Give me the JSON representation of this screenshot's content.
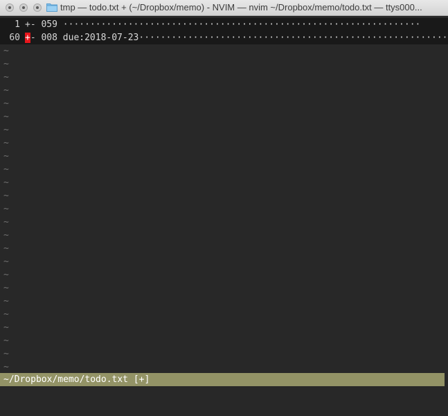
{
  "window": {
    "title": "tmp — todo.txt + (~/Dropbox/memo) - NVIM — nvim ~/Dropbox/memo/todo.txt — ttys000..."
  },
  "editor": {
    "folds": [
      {
        "line_number": "1",
        "marker": "+-",
        "text": " 059 ",
        "dots": "··································································"
      },
      {
        "line_number": "60",
        "marker_cursor": "+",
        "marker_rest": "-",
        "text": " 008 due:2018-07-23",
        "dots": "································································"
      }
    ],
    "empty_line_marker": "~",
    "empty_line_count": 25
  },
  "statusline": {
    "text": "~/Dropbox/memo/todo.txt [+]"
  },
  "colors": {
    "background": "#282828",
    "fold_background": "#191919",
    "statusline_background": "#939366",
    "cursor": "#e8161c",
    "tilde": "#6f6f6f"
  }
}
